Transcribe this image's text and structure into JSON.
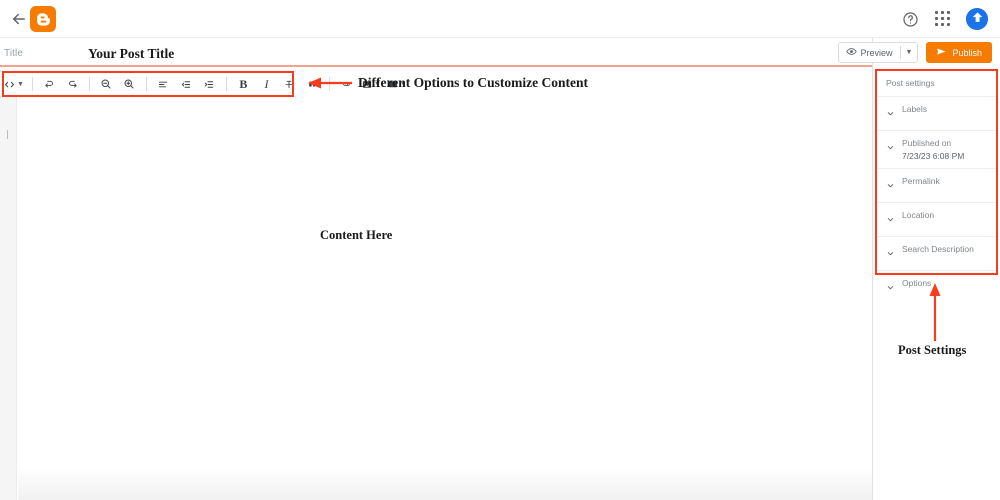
{
  "app": {
    "name": "Blogger",
    "logo_icon": "blogger-logo-icon",
    "accent_orange": "#f57c00",
    "annotation_red": "#fb3b1e",
    "avatar_blue": "#1a73e8"
  },
  "header": {
    "back_icon": "back-arrow-icon",
    "help_icon": "help-circle-icon",
    "apps_icon": "apps-grid-icon",
    "avatar_icon": "user-avatar-icon"
  },
  "title_field": {
    "placeholder": "Title",
    "value": ""
  },
  "actions": {
    "preview_label": "Preview",
    "preview_icon": "eye-icon",
    "preview_dropdown_icon": "chevron-down-icon",
    "publish_label": "Publish",
    "publish_icon": "send-icon"
  },
  "toolbar": {
    "items": [
      {
        "name": "code-view-button",
        "icon": "code-brackets-icon",
        "glyph": "<>",
        "has_dropdown": true
      },
      {
        "name": "undo-button",
        "icon": "undo-icon",
        "has_dropdown": false
      },
      {
        "name": "redo-button",
        "icon": "redo-icon",
        "has_dropdown": false
      },
      {
        "name": "zoom-out-button",
        "icon": "magnifier-minus-icon",
        "has_dropdown": false
      },
      {
        "name": "zoom-in-button",
        "icon": "magnifier-plus-icon",
        "has_dropdown": false
      },
      {
        "name": "align-button",
        "icon": "align-left-icon",
        "has_dropdown": false
      },
      {
        "name": "indent-decrease-button",
        "icon": "indent-decrease-icon",
        "has_dropdown": false
      },
      {
        "name": "indent-increase-button",
        "icon": "indent-increase-icon",
        "has_dropdown": false
      },
      {
        "name": "bold-button",
        "icon": "bold-icon",
        "glyph": "B",
        "has_dropdown": false
      },
      {
        "name": "italic-button",
        "icon": "italic-icon",
        "glyph": "I",
        "has_dropdown": false
      },
      {
        "name": "strikethrough-button",
        "icon": "strikethrough-icon",
        "has_dropdown": false
      },
      {
        "name": "quote-button",
        "icon": "quote-icon",
        "has_dropdown": false
      },
      {
        "name": "link-button",
        "icon": "link-icon",
        "has_dropdown": false
      },
      {
        "name": "insert-image-button",
        "icon": "image-icon",
        "has_dropdown": true
      },
      {
        "name": "insert-video-button",
        "icon": "video-icon",
        "has_dropdown": true
      }
    ]
  },
  "content_area": {
    "value": ""
  },
  "post_settings": {
    "title": "Post settings",
    "chevron_icon": "chevron-down-icon",
    "rows": [
      {
        "label": "Labels",
        "sub": ""
      },
      {
        "label": "Published on",
        "sub": "7/23/23 6:08 PM"
      },
      {
        "label": "Permalink",
        "sub": ""
      },
      {
        "label": "Location",
        "sub": ""
      },
      {
        "label": "Search Description",
        "sub": ""
      },
      {
        "label": "Options",
        "sub": ""
      }
    ]
  },
  "annotations": {
    "title_callout": "Your Post Title",
    "toolbar_callout": "Different Options to Customize Content",
    "content_callout": "Content Here",
    "settings_callout": "Post Settings"
  }
}
